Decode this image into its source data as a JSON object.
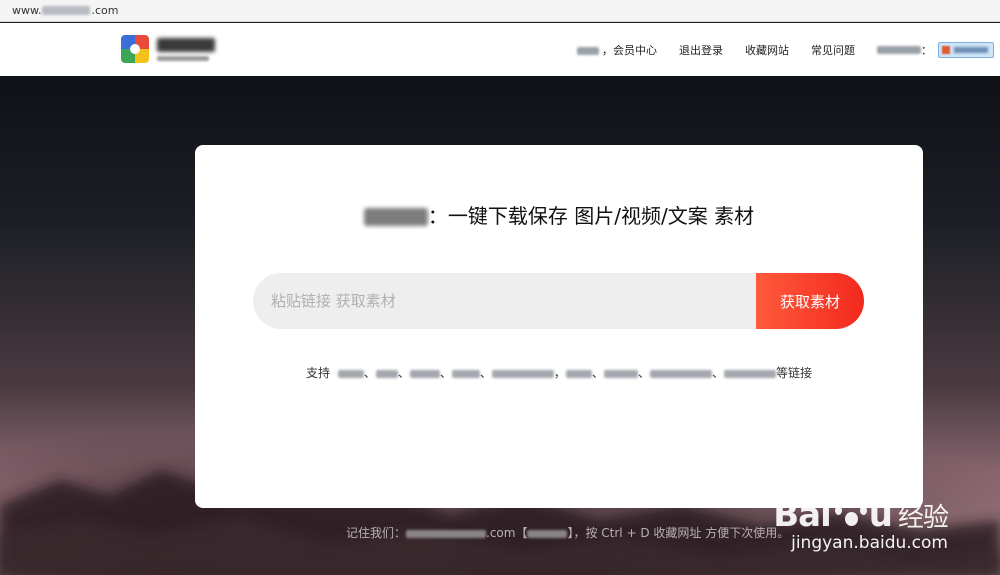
{
  "browser": {
    "url_prefix": "www.",
    "url_suffix": ".com"
  },
  "header": {
    "nav": {
      "member_center": "，会员中心",
      "logout": "退出登录",
      "bookmark": "收藏网站",
      "faq": "常见问题"
    },
    "account_separator": "："
  },
  "card": {
    "title_suffix": "：一键下载保存 图片/视频/文案 素材",
    "search_placeholder": "粘贴链接 获取素材",
    "search_button": "获取素材",
    "support_prefix": "支持",
    "support_suffix": "等链接",
    "separator": "、",
    "comma": "，"
  },
  "footer": {
    "prefix": "记住我们：",
    "domain_suffix": ".com【",
    "mid": "】，按 Ctrl + D 收藏网址 方便下次使用。"
  },
  "watermark": {
    "brand_left": "Bai",
    "brand_right": "u",
    "brand_cn": "经验",
    "url": "jingyan.baidu.com"
  }
}
